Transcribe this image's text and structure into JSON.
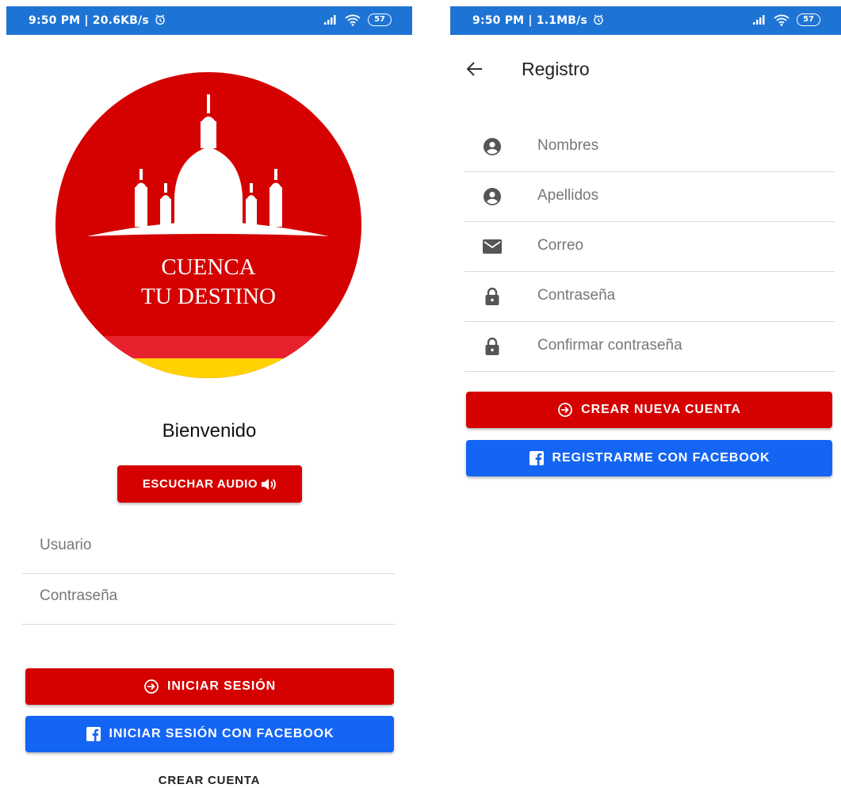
{
  "login": {
    "status_time": "9:50 PM | 20.6KB/s",
    "battery": "57",
    "logo_text_line1": "CUENCA",
    "logo_text_line2": "TU DESTINO",
    "welcome": "Bienvenido",
    "audio_button": "ESCUCHAR AUDIO",
    "username_placeholder": "Usuario",
    "password_placeholder": "Contraseña",
    "login_button": "INICIAR SESIÓN",
    "facebook_button": "INICIAR SESIÓN CON FACEBOOK",
    "create_account_link": "CREAR CUENTA"
  },
  "register": {
    "status_time": "9:50 PM | 1.1MB/s",
    "battery": "57",
    "title": "Registro",
    "fields": [
      {
        "label": "Nombres",
        "icon": "account-circle-icon"
      },
      {
        "label": "Apellidos",
        "icon": "account-circle-icon"
      },
      {
        "label": "Correo",
        "icon": "mail-icon"
      },
      {
        "label": "Contraseña",
        "icon": "lock-icon"
      },
      {
        "label": "Confirmar contraseña",
        "icon": "lock-icon"
      }
    ],
    "create_button": "CREAR NUEVA CUENTA",
    "facebook_button": "REGISTRARME CON FACEBOOK"
  },
  "colors": {
    "status_bar": "#1e74d4",
    "primary_red": "#d50000",
    "facebook_blue": "#1565f5",
    "logo_yellow": "#ffd200"
  }
}
